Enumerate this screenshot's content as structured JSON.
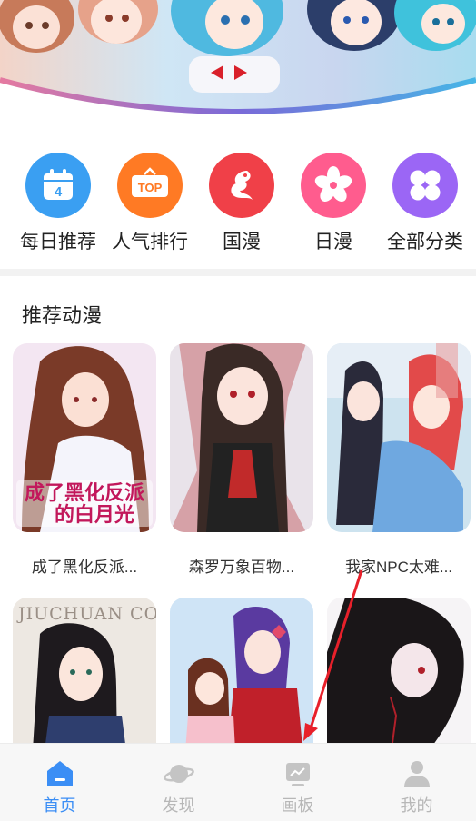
{
  "categories": [
    {
      "label": "每日推荐",
      "icon": "calendar-icon",
      "color": "#3a9ff2",
      "badge": "4"
    },
    {
      "label": "人气排行",
      "icon": "top-icon",
      "color": "#ff7a24",
      "badge": "TOP"
    },
    {
      "label": "国漫",
      "icon": "dragon-icon",
      "color": "#f04048"
    },
    {
      "label": "日漫",
      "icon": "sakura-icon",
      "color": "#ff5c8e"
    },
    {
      "label": "全部分类",
      "icon": "grid-clover-icon",
      "color": "#9b66f5"
    }
  ],
  "section": {
    "title": "推荐动漫"
  },
  "comics": [
    {
      "title": "成了黑化反派...",
      "cover_text": "成了黑化反派的白月光"
    },
    {
      "title": "森罗万象百物..."
    },
    {
      "title": "我家NPC太难..."
    },
    {
      "title": "",
      "cover_text": "JIUCHUAN COMIC"
    },
    {
      "title": ""
    },
    {
      "title": ""
    }
  ],
  "tabbar": {
    "items": [
      {
        "label": "首页",
        "icon": "home-icon",
        "active": true
      },
      {
        "label": "发现",
        "icon": "planet-icon",
        "active": false
      },
      {
        "label": "画板",
        "icon": "monitor-icon",
        "active": false
      },
      {
        "label": "我的",
        "icon": "user-icon",
        "active": false
      }
    ]
  },
  "colors": {
    "accent": "#3b8ef5",
    "tab_inactive": "#b7b7b7",
    "annotation": "#e8202a"
  }
}
